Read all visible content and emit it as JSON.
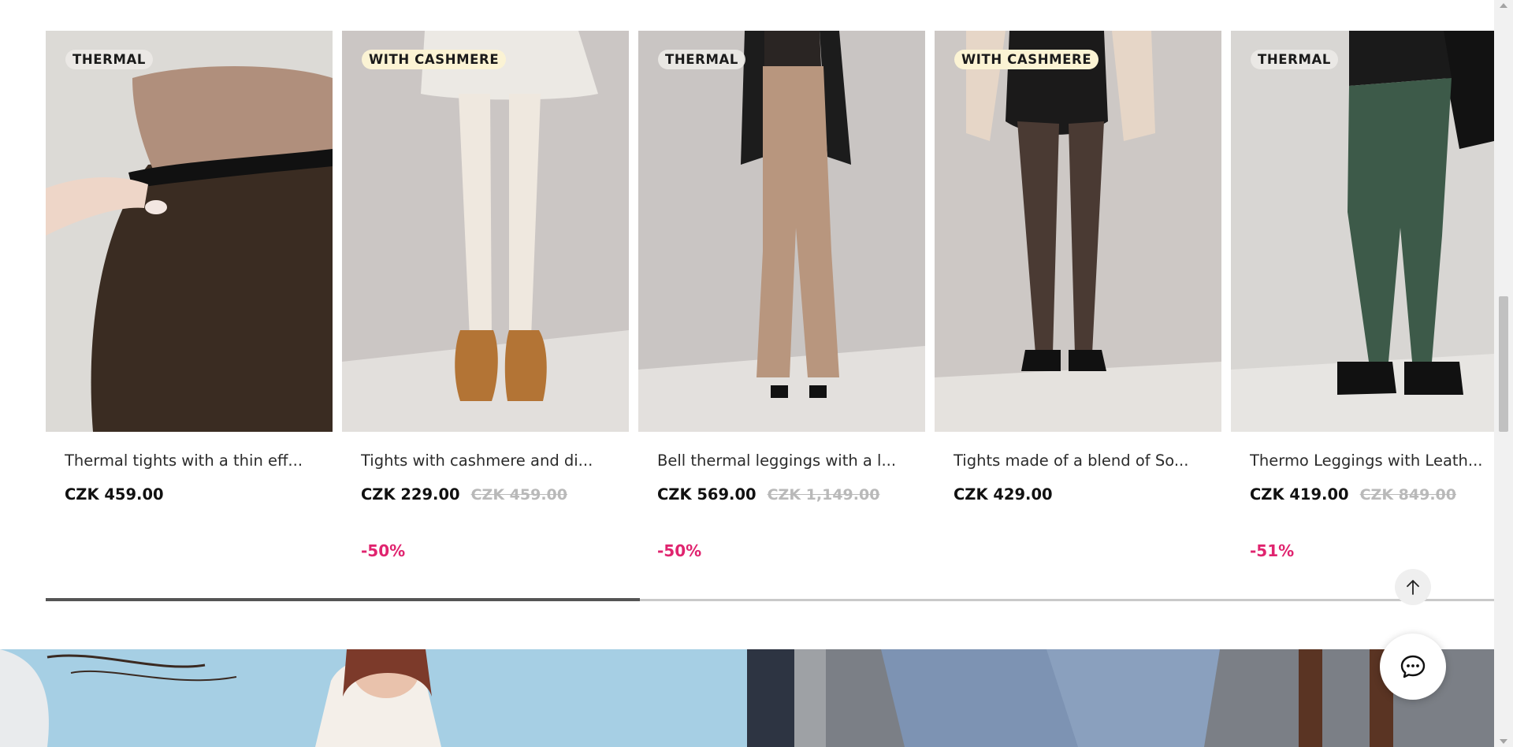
{
  "products": [
    {
      "badge": "THERMAL",
      "title": "Thermal tights with a thin eff...",
      "price": "CZK 459.00",
      "old_price": "",
      "discount": ""
    },
    {
      "badge": "WITH CASHMERE",
      "title": "Tights with cashmere and di...",
      "price": "CZK 229.00",
      "old_price": "CZK 459.00",
      "discount": "-50%"
    },
    {
      "badge": "THERMAL",
      "title": "Bell thermal leggings with a l...",
      "price": "CZK 569.00",
      "old_price": "CZK 1,149.00",
      "discount": "-50%"
    },
    {
      "badge": "WITH CASHMERE",
      "title": "Tights made of a blend of So...",
      "price": "CZK 429.00",
      "old_price": "",
      "discount": ""
    },
    {
      "badge": "THERMAL",
      "title": "Thermo Leggings with Leath...",
      "price": "CZK 419.00",
      "old_price": "CZK 849.00",
      "discount": "-51%"
    }
  ],
  "carousel_progress": 0.41,
  "icons": {
    "back_to_top": "arrow-up-icon",
    "chat": "chat-bubble-icon"
  },
  "colors": {
    "discount": "#e0246f",
    "thermal_badge": "#ece9e6",
    "cashmere_badge": "#fbf3d4"
  }
}
